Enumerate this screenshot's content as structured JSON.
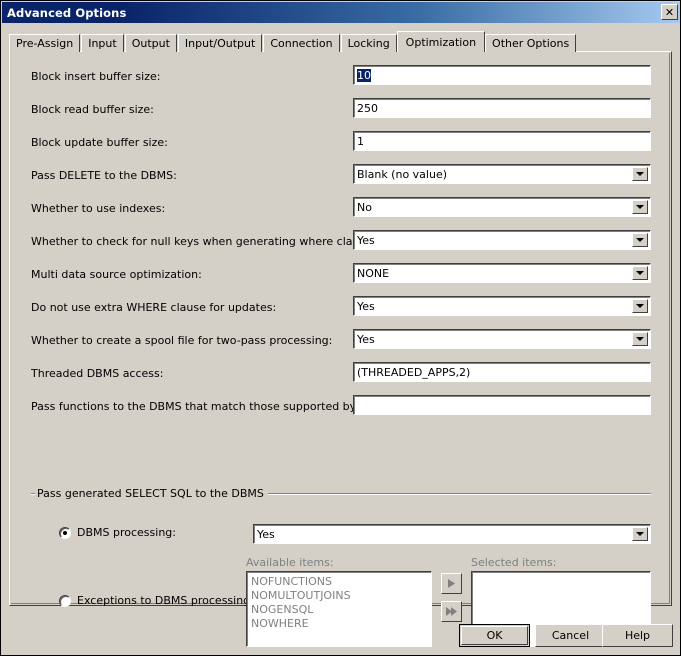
{
  "window": {
    "title": "Advanced Options",
    "close_icon": "close-icon",
    "close_glyph": "✕"
  },
  "tabs": [
    {
      "label": "Pre-Assign",
      "active": false
    },
    {
      "label": "Input",
      "active": false
    },
    {
      "label": "Output",
      "active": false
    },
    {
      "label": "Input/Output",
      "active": false
    },
    {
      "label": "Connection",
      "active": false
    },
    {
      "label": "Locking",
      "active": false
    },
    {
      "label": "Optimization",
      "active": true
    },
    {
      "label": "Other Options",
      "active": false
    }
  ],
  "fields": [
    {
      "name": "block-insert-buffer-size",
      "label": "Block insert buffer size:",
      "type": "text",
      "value": "10",
      "selected": true
    },
    {
      "name": "block-read-buffer-size",
      "label": "Block read buffer size:",
      "type": "text",
      "value": "250",
      "selected": false
    },
    {
      "name": "block-update-buffer-size",
      "label": "Block update buffer size:",
      "type": "text",
      "value": "1",
      "selected": false
    },
    {
      "name": "pass-delete-to-dbms",
      "label": "Pass DELETE  to the DBMS:",
      "type": "combo",
      "value": "Blank (no value)",
      "selected": false
    },
    {
      "name": "whether-to-use-indexes",
      "label": "Whether to use indexes:",
      "type": "combo",
      "value": "No",
      "selected": false
    },
    {
      "name": "check-null-keys-where-clauses",
      "label": "Whether to check for null keys when generating where clauses:",
      "type": "combo",
      "value": "Yes",
      "selected": false
    },
    {
      "name": "multi-data-source-optimization",
      "label": "Multi data source optimization:",
      "type": "combo",
      "value": "NONE",
      "selected": false
    },
    {
      "name": "no-extra-where-clause-updates",
      "label": "Do not use extra WHERE clause for updates:",
      "type": "combo",
      "value": "Yes",
      "selected": false
    },
    {
      "name": "spool-file-two-pass-processing",
      "label": "Whether to create a spool file for two-pass processing:",
      "type": "combo",
      "value": "Yes",
      "selected": false
    },
    {
      "name": "threaded-dbms-access",
      "label": "Threaded DBMS access:",
      "type": "text",
      "value": "(THREADED_APPS,2)",
      "selected": false
    },
    {
      "name": "pass-functions-to-dbms",
      "label": "Pass functions to the DBMS that match those supported by SAS:",
      "type": "text",
      "value": "",
      "selected": false
    }
  ],
  "group": {
    "title": "Pass generated SELECT SQL to the DBMS",
    "dbms_processing": {
      "label": "DBMS processing:",
      "checked": true,
      "value": "Yes"
    },
    "exceptions": {
      "label": "Exceptions to DBMS processing:",
      "checked": false
    },
    "available": {
      "caption": "Available items:",
      "items": [
        "NOFUNCTIONS",
        "NOMULTOUTJOINS",
        "NOGENSQL",
        "NOWHERE"
      ]
    },
    "selected": {
      "caption": "Selected items:",
      "items": []
    },
    "move_one_icon": "arrow-right-icon",
    "move_all_icon": "double-arrow-right-icon"
  },
  "buttons": {
    "ok": "OK",
    "cancel": "Cancel",
    "help": "Help"
  },
  "colors": {
    "face": "#d4d0c8",
    "title_start": "#0a246a",
    "title_end": "#a6caf0",
    "selection": "#0a246a",
    "disabled_text": "#808080"
  }
}
